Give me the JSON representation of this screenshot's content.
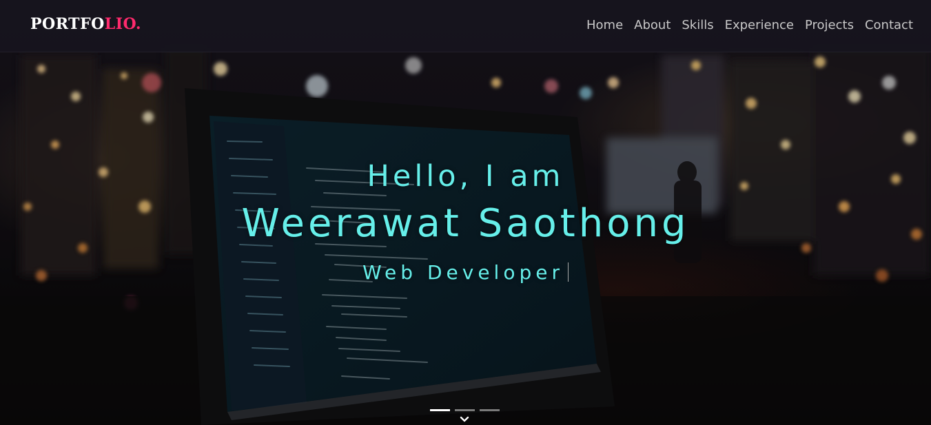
{
  "navbar": {
    "brand_main": "PORTFO",
    "brand_accent": "LIO.",
    "links": [
      {
        "label": "Home"
      },
      {
        "label": "About"
      },
      {
        "label": "Skills"
      },
      {
        "label": "Experience"
      },
      {
        "label": "Projects"
      },
      {
        "label": "Contact"
      }
    ]
  },
  "hero": {
    "greeting": "Hello, I am",
    "name": "Weerawat Saothong",
    "role": "Web Developer",
    "slide_count": 3,
    "active_slide": 1
  },
  "colors": {
    "accent_brand": "#ff2a6d",
    "hero_text": "#66efea",
    "navbar_bg": "#16141e",
    "nav_link": "#c9c9c9"
  },
  "icons": {
    "scroll_down": "chevron-down-icon"
  }
}
